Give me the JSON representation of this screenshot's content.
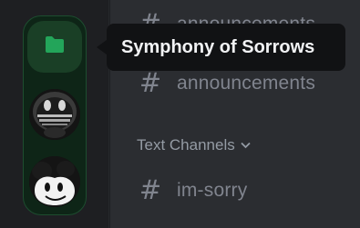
{
  "server_rail": {
    "folder": {
      "icon": "folder-icon",
      "color": "#23a55a"
    },
    "servers": [
      {
        "icon": "server-avatar-icon",
        "art_text": "SYMPHONY OF SORROWS"
      },
      {
        "icon": "mouse-head-avatar-icon"
      }
    ]
  },
  "tooltip": {
    "text": "Symphony of Sorrows"
  },
  "channels": {
    "top_hidden": {
      "label": "announcements"
    },
    "announcements": {
      "label": "announcements"
    },
    "category_label": "Text Channels",
    "im_sorry": {
      "label": "im-sorry"
    },
    "hash_symbol": "#"
  }
}
